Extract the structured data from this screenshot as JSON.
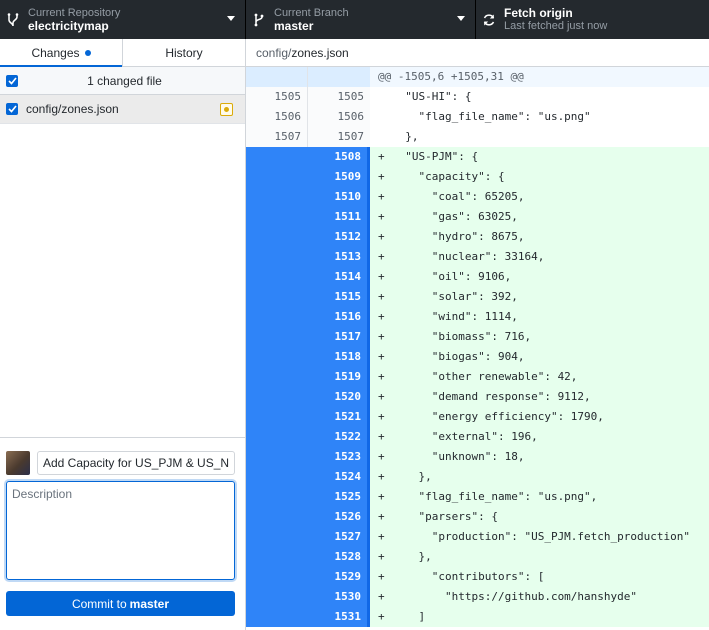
{
  "toolbar": {
    "repo": {
      "label": "Current Repository",
      "name": "electricitymap"
    },
    "branch": {
      "label": "Current Branch",
      "name": "master"
    },
    "fetch": {
      "label": "Fetch origin",
      "status": "Last fetched just now"
    }
  },
  "sidebar": {
    "tabs": [
      {
        "label": "Changes",
        "active": true
      },
      {
        "label": "History",
        "active": false
      }
    ],
    "changed_count_label": "1 changed file",
    "files": [
      {
        "path": "config/zones.json",
        "status_icon": "modified-icon"
      }
    ],
    "commit": {
      "summary_value": "Add Capacity for US_PJM & US_N",
      "description_placeholder": "Description",
      "button_prefix": "Commit to",
      "button_branch": "master"
    }
  },
  "diff": {
    "file_dir": "config/",
    "file_name": "zones.json",
    "hunk": "@@ -1505,6 +1505,31 @@",
    "lines": [
      {
        "type": "ctx",
        "old": "1505",
        "new": "1505",
        "text": "  \"US-HI\": {"
      },
      {
        "type": "ctx",
        "old": "1506",
        "new": "1506",
        "text": "    \"flag_file_name\": \"us.png\""
      },
      {
        "type": "ctx",
        "old": "1507",
        "new": "1507",
        "text": "  },"
      },
      {
        "type": "add",
        "new": "1508",
        "text": "  \"US-PJM\": {"
      },
      {
        "type": "add",
        "new": "1509",
        "text": "    \"capacity\": {"
      },
      {
        "type": "add",
        "new": "1510",
        "text": "      \"coal\": 65205,"
      },
      {
        "type": "add",
        "new": "1511",
        "text": "      \"gas\": 63025,"
      },
      {
        "type": "add",
        "new": "1512",
        "text": "      \"hydro\": 8675,"
      },
      {
        "type": "add",
        "new": "1513",
        "text": "      \"nuclear\": 33164,"
      },
      {
        "type": "add",
        "new": "1514",
        "text": "      \"oil\": 9106,"
      },
      {
        "type": "add",
        "new": "1515",
        "text": "      \"solar\": 392,"
      },
      {
        "type": "add",
        "new": "1516",
        "text": "      \"wind\": 1114,"
      },
      {
        "type": "add",
        "new": "1517",
        "text": "      \"biomass\": 716,"
      },
      {
        "type": "add",
        "new": "1518",
        "text": "      \"biogas\": 904,"
      },
      {
        "type": "add",
        "new": "1519",
        "text": "      \"other renewable\": 42,"
      },
      {
        "type": "add",
        "new": "1520",
        "text": "      \"demand response\": 9112,"
      },
      {
        "type": "add",
        "new": "1521",
        "text": "      \"energy efficiency\": 1790,"
      },
      {
        "type": "add",
        "new": "1522",
        "text": "      \"external\": 196,"
      },
      {
        "type": "add",
        "new": "1523",
        "text": "      \"unknown\": 18,"
      },
      {
        "type": "add",
        "new": "1524",
        "text": "    },"
      },
      {
        "type": "add",
        "new": "1525",
        "text": "    \"flag_file_name\": \"us.png\","
      },
      {
        "type": "add",
        "new": "1526",
        "text": "    \"parsers\": {"
      },
      {
        "type": "add",
        "new": "1527",
        "text": "      \"production\": \"US_PJM.fetch_production\""
      },
      {
        "type": "add",
        "new": "1528",
        "text": "    },"
      },
      {
        "type": "add",
        "new": "1529",
        "text": "      \"contributors\": ["
      },
      {
        "type": "add",
        "new": "1530",
        "text": "        \"https://github.com/hanshyde\""
      },
      {
        "type": "add",
        "new": "1531",
        "text": "    ]"
      }
    ]
  },
  "colors": {
    "toolbar_bg": "#24292e",
    "accent": "#0366d6",
    "added_bg": "#e6ffed",
    "gutter_selected": "#2f84f8",
    "modified": "#dbab09"
  }
}
